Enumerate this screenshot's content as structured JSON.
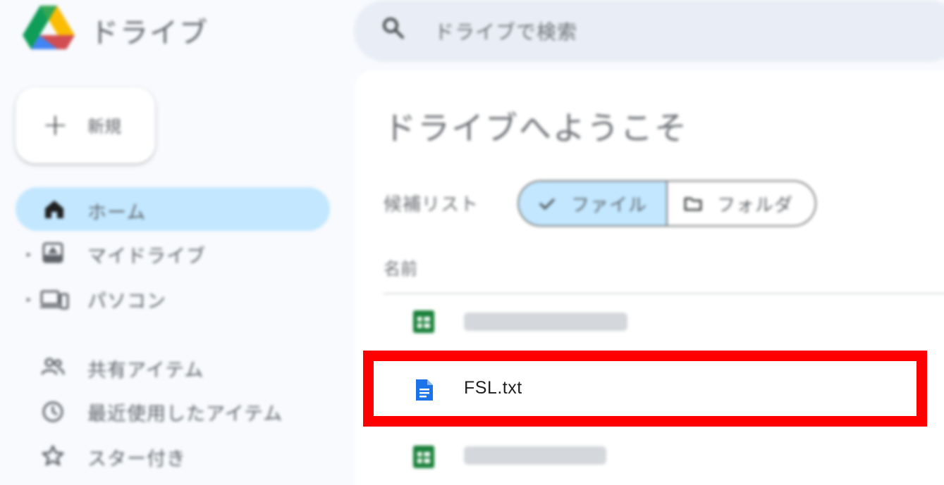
{
  "app": {
    "title": "ドライブ"
  },
  "search": {
    "placeholder": "ドライブで検索"
  },
  "sidebar": {
    "new_label": "新規",
    "items": [
      {
        "label": "ホーム",
        "icon": "home-icon",
        "active": true
      },
      {
        "label": "マイドライブ",
        "icon": "my-drive-icon",
        "active": false
      },
      {
        "label": "パソコン",
        "icon": "computers-icon",
        "active": false
      },
      {
        "label": "共有アイテム",
        "icon": "shared-icon",
        "active": false
      },
      {
        "label": "最近使用したアイテム",
        "icon": "recent-clock-icon",
        "active": false
      },
      {
        "label": "スター付き",
        "icon": "star-icon",
        "active": false
      }
    ]
  },
  "main": {
    "welcome": "ドライブへようこそ",
    "suggested_label": "候補リスト",
    "chips": [
      {
        "label": "ファイル",
        "icon": "check-icon",
        "selected": true
      },
      {
        "label": "フォルダ",
        "icon": "folder-icon",
        "selected": false
      }
    ],
    "column_name": "名前",
    "files": [
      {
        "name": "",
        "icon": "sheets-icon",
        "redacted": true
      },
      {
        "name": "FSL.txt",
        "icon": "docs-icon",
        "redacted": false
      },
      {
        "name": "",
        "icon": "sheets-icon",
        "redacted": true
      }
    ]
  },
  "colors": {
    "accent": "#c2e7ff",
    "highlight_frame": "#ff0000",
    "sheets_green": "#188038",
    "docs_blue": "#1a73e8"
  }
}
